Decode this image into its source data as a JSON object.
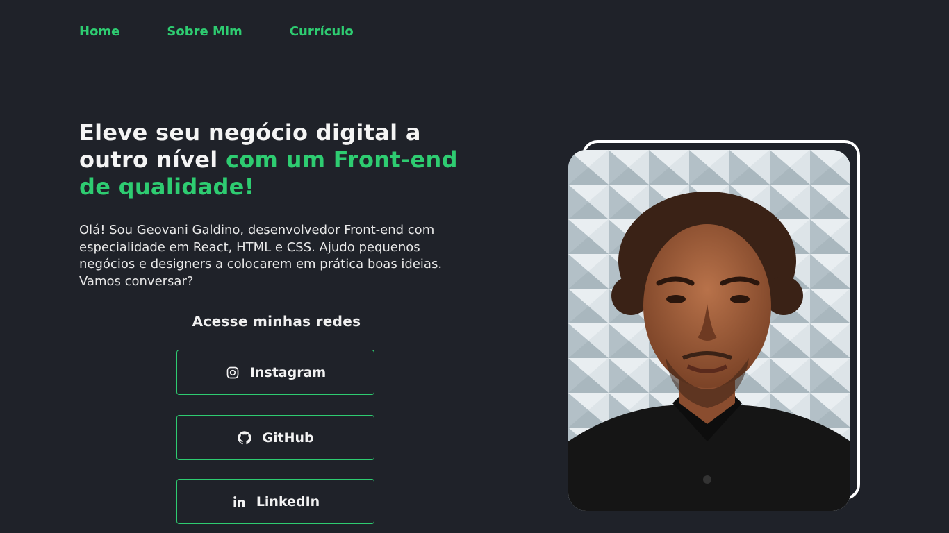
{
  "nav": {
    "items": [
      {
        "label": "Home"
      },
      {
        "label": "Sobre Mim"
      },
      {
        "label": "Currículo"
      }
    ]
  },
  "hero": {
    "title_part1": "Eleve seu negócio digital a outro nível ",
    "title_accent": "com um Front-end de qualidade!",
    "description": "Olá! Sou Geovani Galdino, desenvolvedor Front-end com especialidade em React, HTML e CSS. Ajudo pequenos negócios e designers a colocarem em prática boas ideias. Vamos conversar?"
  },
  "social": {
    "title": "Acesse minhas redes",
    "buttons": [
      {
        "label": "Instagram",
        "icon": "instagram-icon"
      },
      {
        "label": "GitHub",
        "icon": "github-icon"
      },
      {
        "label": "LinkedIn",
        "icon": "linkedin-icon"
      }
    ]
  },
  "colors": {
    "background": "#1f2229",
    "accent": "#2ecc71",
    "text": "#f1f1f1",
    "frame": "#ffffff"
  }
}
